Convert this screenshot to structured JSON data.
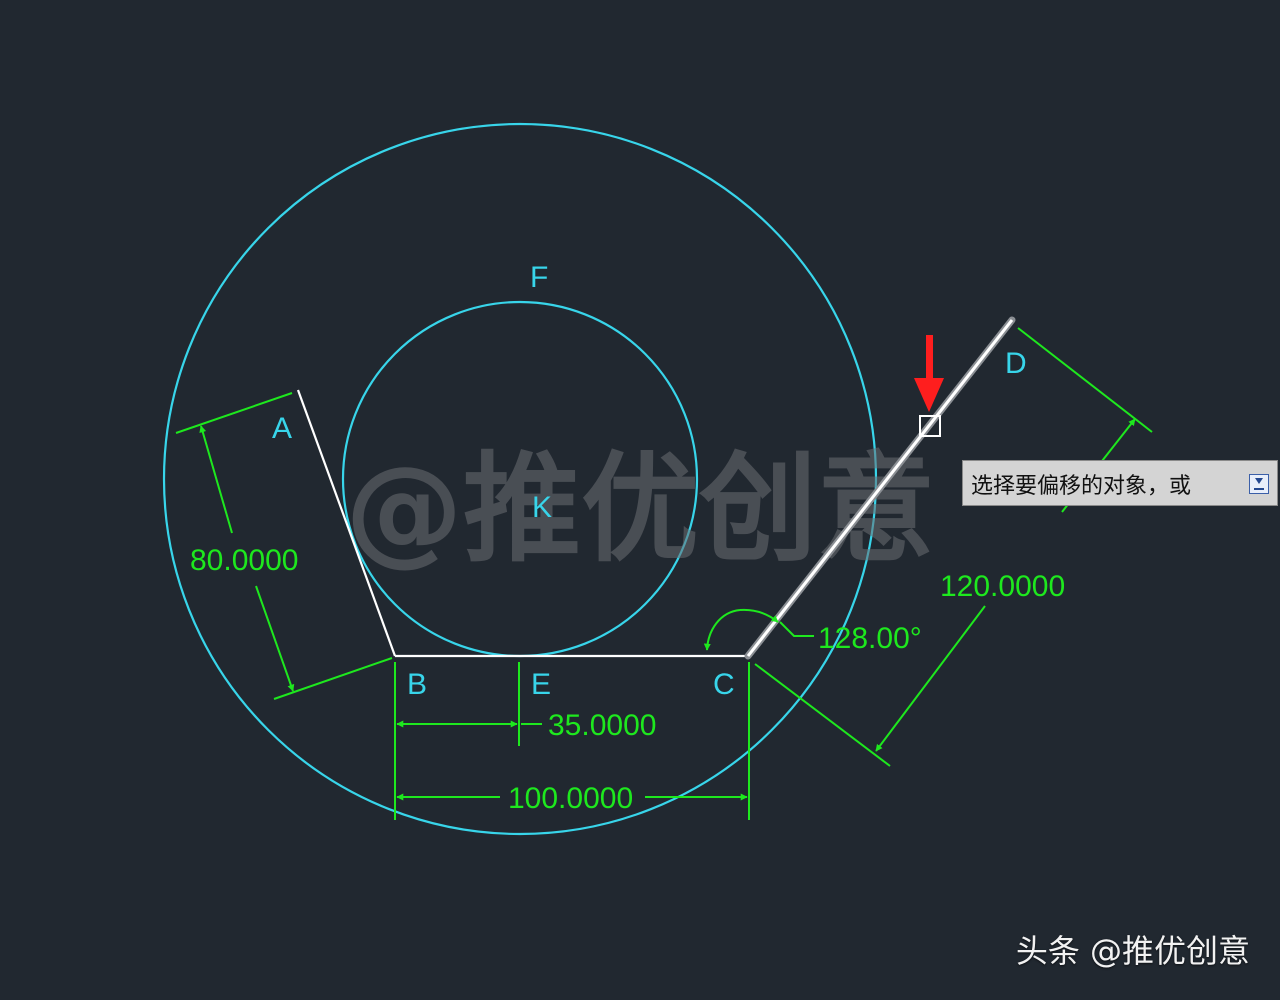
{
  "drawing": {
    "background": "#212830",
    "colors": {
      "circles": "#38d5ea",
      "geometry": "#ffffff",
      "dimensions": "#1ee81e",
      "marker_arrow": "#ff1e1e"
    },
    "points": {
      "A": "A",
      "B": "B",
      "C": "C",
      "D": "D",
      "E": "E",
      "F": "F",
      "K": "K"
    },
    "dimensions": {
      "ab_length": "80.0000",
      "be_length": "35.0000",
      "bc_length": "100.0000",
      "cd_length": "120.0000",
      "angle_c": "128.00°"
    },
    "watermark": "@推优创意"
  },
  "tooltip": {
    "prompt": "选择要偏移的对象，或",
    "menu_icon": "dropdown-menu-icon"
  },
  "credit": "头条 @推优创意"
}
